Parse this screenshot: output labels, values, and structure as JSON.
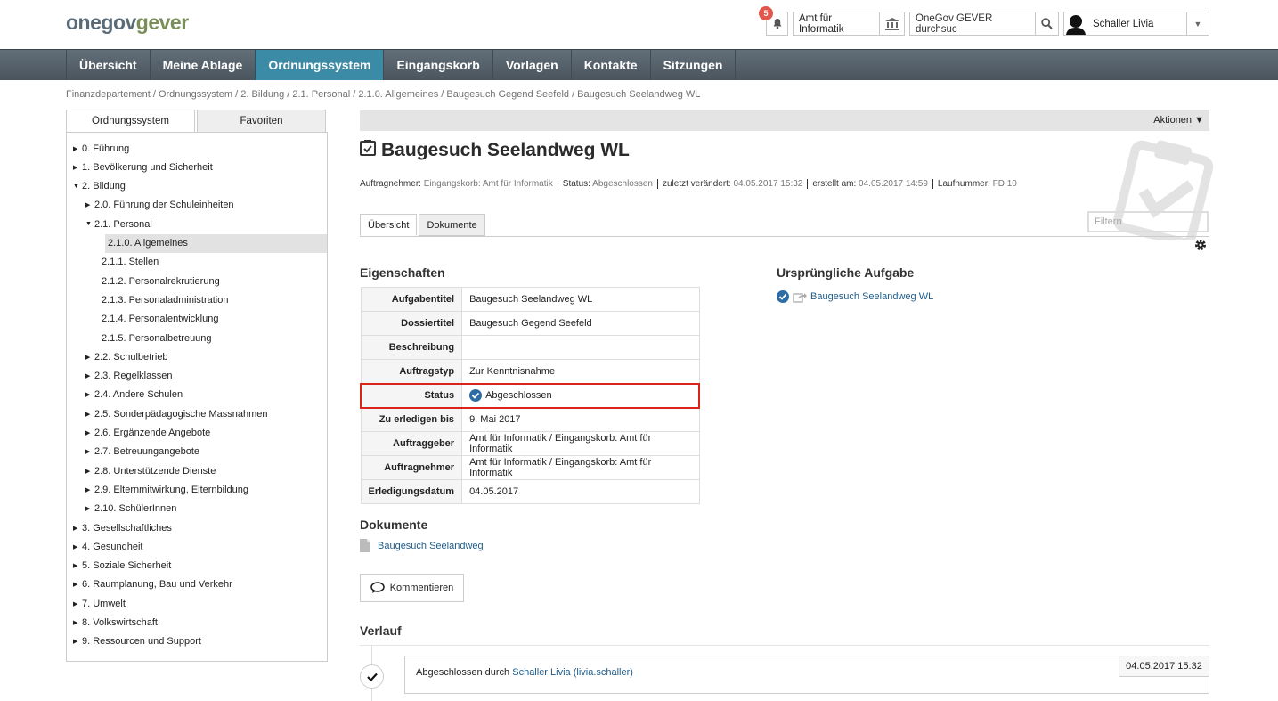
{
  "header": {
    "logo_part1": "onegov",
    "logo_part2": "gever",
    "notification_count": "5",
    "org_unit": "Amt für Informatik",
    "search_placeholder": "OneGov GEVER durchsuc",
    "user_name": "Schaller Livia"
  },
  "nav": {
    "items": [
      "Übersicht",
      "Meine Ablage",
      "Ordnungssystem",
      "Eingangskorb",
      "Vorlagen",
      "Kontakte",
      "Sitzungen"
    ],
    "active": "Ordnungssystem"
  },
  "breadcrumb": "Finanzdepartement / Ordnungssystem / 2. Bildung / 2.1. Personal / 2.1.0. Allgemeines / Baugesuch Gegend Seefeld / Baugesuch Seelandweg WL",
  "sidebar": {
    "tabs": [
      "Ordnungssystem",
      "Favoriten"
    ],
    "tree": [
      {
        "label": "0. Führung",
        "arrow": "▶",
        "level": 0
      },
      {
        "label": "1. Bevölkerung und Sicherheit",
        "arrow": "▶",
        "level": 0
      },
      {
        "label": "2. Bildung",
        "arrow": "▼",
        "level": 0
      },
      {
        "label": "2.0. Führung der Schuleinheiten",
        "arrow": "▶",
        "level": 1
      },
      {
        "label": "2.1. Personal",
        "arrow": "▼",
        "level": 1
      },
      {
        "label": "2.1.0. Allgemeines",
        "arrow": "",
        "level": 2,
        "selected": true
      },
      {
        "label": "2.1.1. Stellen",
        "arrow": "",
        "level": 2
      },
      {
        "label": "2.1.2. Personalrekrutierung",
        "arrow": "",
        "level": 2
      },
      {
        "label": "2.1.3. Personaladministration",
        "arrow": "",
        "level": 2
      },
      {
        "label": "2.1.4. Personalentwicklung",
        "arrow": "",
        "level": 2
      },
      {
        "label": "2.1.5. Personalbetreuung",
        "arrow": "",
        "level": 2
      },
      {
        "label": "2.2. Schulbetrieb",
        "arrow": "▶",
        "level": 1
      },
      {
        "label": "2.3. Regelklassen",
        "arrow": "▶",
        "level": 1
      },
      {
        "label": "2.4. Andere Schulen",
        "arrow": "▶",
        "level": 1
      },
      {
        "label": "2.5. Sonderpädagogische Massnahmen",
        "arrow": "▶",
        "level": 1
      },
      {
        "label": "2.6. Ergänzende Angebote",
        "arrow": "▶",
        "level": 1
      },
      {
        "label": "2.7. Betreuungangebote",
        "arrow": "▶",
        "level": 1
      },
      {
        "label": "2.8. Unterstützende Dienste",
        "arrow": "▶",
        "level": 1
      },
      {
        "label": "2.9. Elternmitwirkung, Elternbildung",
        "arrow": "▶",
        "level": 1
      },
      {
        "label": "2.10. SchülerInnen",
        "arrow": "▶",
        "level": 1
      },
      {
        "label": "3. Gesellschaftliches",
        "arrow": "▶",
        "level": 0
      },
      {
        "label": "4. Gesundheit",
        "arrow": "▶",
        "level": 0
      },
      {
        "label": "5. Soziale Sicherheit",
        "arrow": "▶",
        "level": 0
      },
      {
        "label": "6. Raumplanung, Bau und Verkehr",
        "arrow": "▶",
        "level": 0
      },
      {
        "label": "7. Umwelt",
        "arrow": "▶",
        "level": 0
      },
      {
        "label": "8. Volkswirtschaft",
        "arrow": "▶",
        "level": 0
      },
      {
        "label": "9. Ressourcen und Support",
        "arrow": "▶",
        "level": 0
      }
    ]
  },
  "actions_label": "Aktionen ▼",
  "task": {
    "title": "Baugesuch Seelandweg WL",
    "meta": [
      {
        "k": "Auftragnehmer:",
        "v": "Eingangskorb: Amt für Informatik"
      },
      {
        "k": "Status:",
        "v": "Abgeschlossen"
      },
      {
        "k": "zuletzt verändert:",
        "v": "04.05.2017 15:32"
      },
      {
        "k": "erstellt am:",
        "v": "04.05.2017 14:59"
      },
      {
        "k": "Laufnummer:",
        "v": "FD 10"
      }
    ]
  },
  "content_tabs": [
    "Übersicht",
    "Dokumente"
  ],
  "filter_placeholder": "Filtern",
  "properties": {
    "heading": "Eigenschaften",
    "rows": [
      {
        "k": "Aufgabentitel",
        "v": "Baugesuch Seelandweg WL"
      },
      {
        "k": "Dossiertitel",
        "v": "Baugesuch Gegend Seefeld"
      },
      {
        "k": "Beschreibung",
        "v": ""
      },
      {
        "k": "Auftragstyp",
        "v": "Zur Kenntnisnahme"
      },
      {
        "k": "Status",
        "v": "Abgeschlossen",
        "highlight": true
      },
      {
        "k": "Zu erledigen bis",
        "v": "9. Mai 2017"
      },
      {
        "k": "Auftraggeber",
        "v": "Amt für Informatik / Eingangskorb: Amt für Informatik"
      },
      {
        "k": "Auftragnehmer",
        "v": "Amt für Informatik / Eingangskorb: Amt für Informatik"
      },
      {
        "k": "Erledigungsdatum",
        "v": "04.05.2017"
      }
    ]
  },
  "original_task": {
    "heading": "Ursprüngliche Aufgabe",
    "link": "Baugesuch Seelandweg WL"
  },
  "documents": {
    "heading": "Dokumente",
    "items": [
      "Baugesuch Seelandweg"
    ]
  },
  "comment_button": "Kommentieren",
  "history": {
    "heading": "Verlauf",
    "entries": [
      {
        "text": "Abgeschlossen durch ",
        "user": "Schaller Livia (livia.schaller)",
        "date": "04.05.2017 15:32"
      }
    ]
  },
  "colors": {
    "nav_active": "#3b8aa6",
    "badge": "#e1574c",
    "highlight": "#d9241b",
    "link": "#1f5c8a",
    "status_check": "#2e6da4"
  }
}
